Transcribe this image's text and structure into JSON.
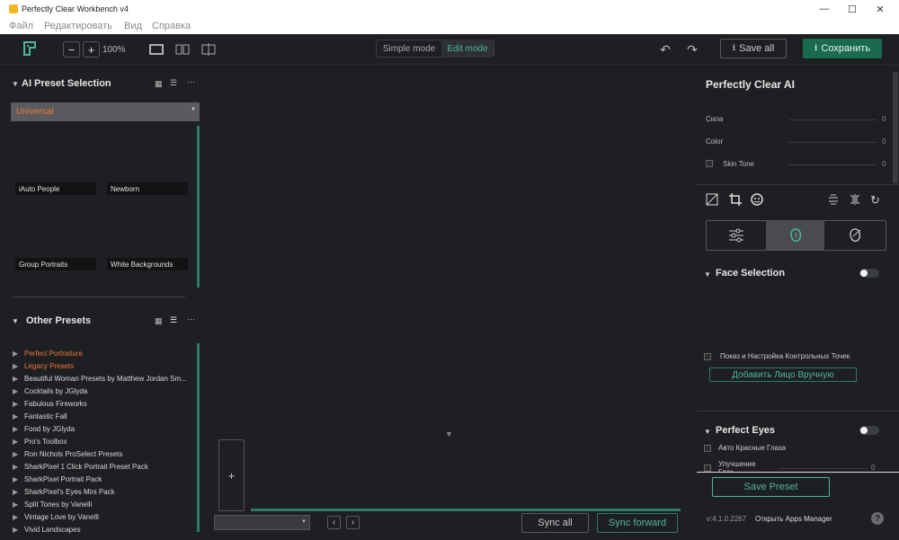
{
  "window": {
    "title": "Perfectly Clear Workbench v4"
  },
  "menu": [
    "Файл",
    "Редактировать",
    "Вид",
    "Справка"
  ],
  "toolbar": {
    "zoom": "100%",
    "simple_mode": "Simple mode",
    "edit_mode": "Edit mode",
    "save_all": "Save all",
    "save": "Сохранить"
  },
  "ai_presets": {
    "title": "AI Preset Selection",
    "selected": "Universal",
    "tiles": [
      "iAuto People",
      "Newborn",
      "Group Portraits",
      "White Backgrounds"
    ]
  },
  "other_presets": {
    "title": "Other Presets",
    "items": [
      {
        "label": "Perfect Portraiture",
        "color": "#e8783a"
      },
      {
        "label": "Legacy Presets",
        "color": "#e8783a"
      },
      {
        "label": "Beautiful Woman Presets by Matthew Jordan Sm...",
        "color": "#d8d8d8"
      },
      {
        "label": "Cocktails by JGlyda",
        "color": "#d8d8d8"
      },
      {
        "label": "Fabulous Fireworks",
        "color": "#d8d8d8"
      },
      {
        "label": "Fantastic Fall",
        "color": "#d8d8d8"
      },
      {
        "label": "Food by JGlyda",
        "color": "#d8d8d8"
      },
      {
        "label": "Pro's Toolbox",
        "color": "#d8d8d8"
      },
      {
        "label": "Ron Nichols ProSelect Presets",
        "color": "#d8d8d8"
      },
      {
        "label": "SharkPixel 1 Click Portrait Preset Pack",
        "color": "#d8d8d8"
      },
      {
        "label": "SharkPixel Portrait Pack",
        "color": "#d8d8d8"
      },
      {
        "label": "SharkPixel's Eyes Mini Pack",
        "color": "#d8d8d8"
      },
      {
        "label": "Split Tones by Vanelli",
        "color": "#d8d8d8"
      },
      {
        "label": "Vintage Love by Vanelli",
        "color": "#d8d8d8"
      },
      {
        "label": "Vivid Landscapes",
        "color": "#d8d8d8"
      }
    ]
  },
  "center": {
    "add_label": "+",
    "sync_all": "Sync all",
    "sync_forward": "Sync forward"
  },
  "right": {
    "title": "Perfectly Clear AI",
    "sliders": [
      {
        "label": "Сила",
        "value": "0"
      },
      {
        "label": "Color",
        "value": "0"
      },
      {
        "label": "Skin Tone",
        "value": "0"
      }
    ],
    "face_selection": {
      "title": "Face Selection",
      "show_points": "Показ и Настройка Контрольных Точек",
      "add_face": "Добавить Лицо Вручную"
    },
    "perfect_eyes": {
      "title": "Perfect Eyes",
      "red_eye": "Авто Красные Глаза",
      "enhance": "Улучшение Глаз",
      "enhance_value": "0"
    },
    "save_preset": "Save Preset",
    "version": "v:4.1.0.2267",
    "apps_manager": "Открыть Apps Manager",
    "help": "?"
  },
  "colors": {
    "accent": "#4fb69a",
    "orange": "#e8783a",
    "save_bg": "#1a6b4e"
  }
}
